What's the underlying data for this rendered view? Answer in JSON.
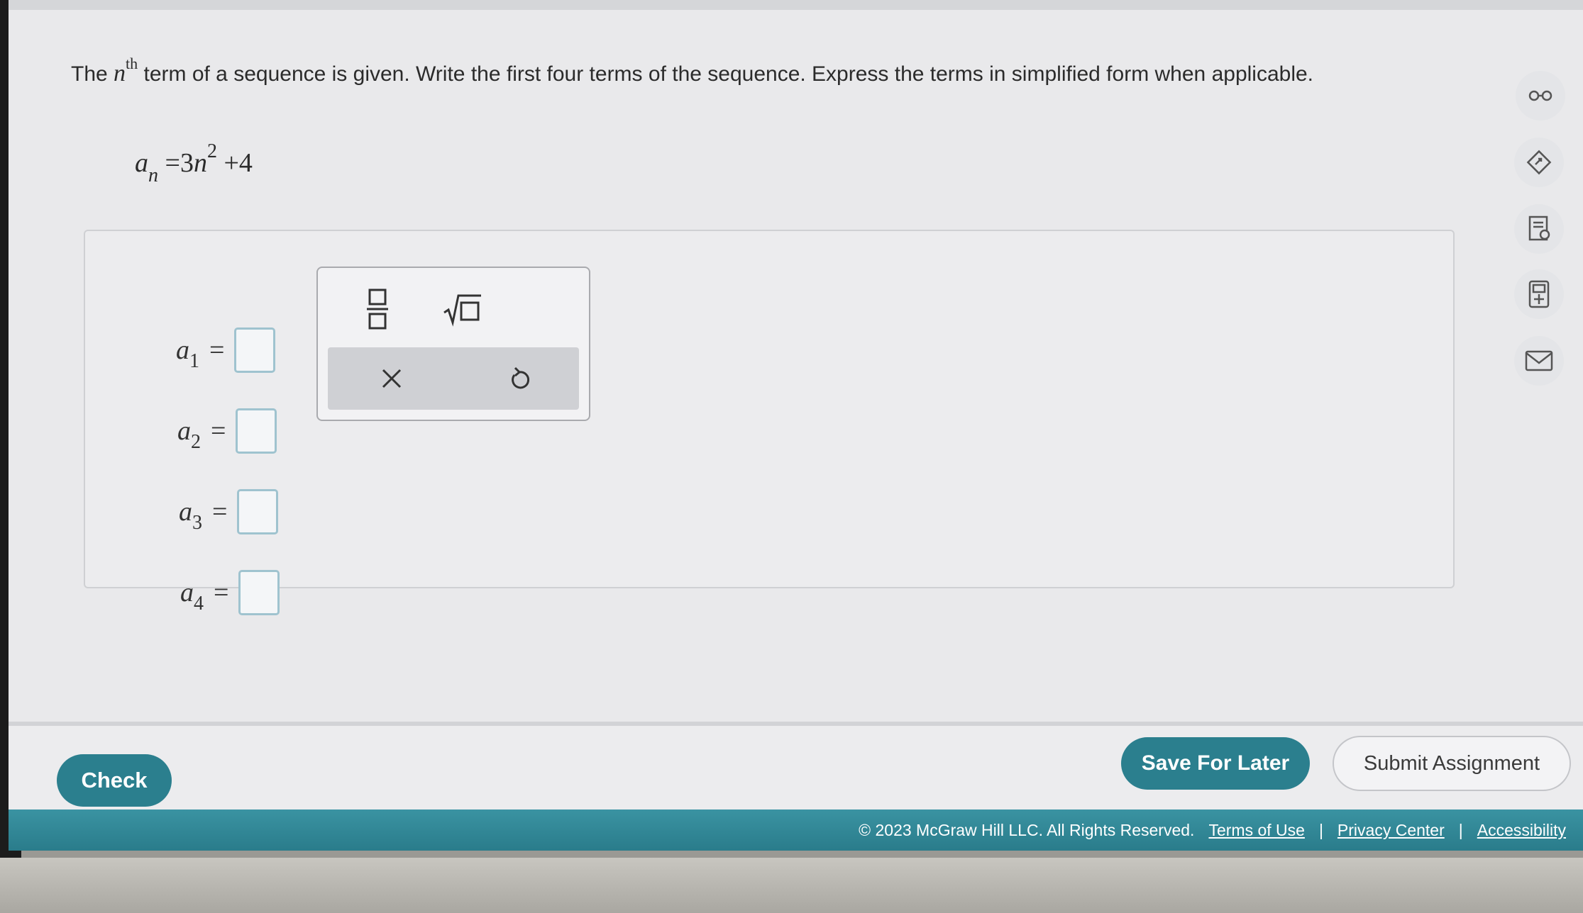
{
  "question": {
    "text_part1": "The ",
    "var_n": "n",
    "sup_th": "th",
    "text_part2": " term of a sequence is given. Write the first four terms of the sequence. Express the terms in simplified form when applicable."
  },
  "formula": {
    "lhs": "a",
    "lhs_sub": "n",
    "equals": "=",
    "coef": "3",
    "var": "n",
    "exp": "2",
    "tail": "+4"
  },
  "answers": [
    {
      "label": "a",
      "sub": "1",
      "value": ""
    },
    {
      "label": "a",
      "sub": "2",
      "value": ""
    },
    {
      "label": "a",
      "sub": "3",
      "value": ""
    },
    {
      "label": "a",
      "sub": "4",
      "value": ""
    }
  ],
  "equals_sign": "=",
  "palette": {
    "fraction_icon": "fraction-template-icon",
    "sqrt_icon": "square-root-template-icon",
    "clear_icon": "clear-x-icon",
    "undo_icon": "undo-icon"
  },
  "rail": [
    "glasses-icon",
    "tag-edit-icon",
    "textbook-icon",
    "calculator-icon",
    "mail-icon"
  ],
  "buttons": {
    "check": "Check",
    "save": "Save For Later",
    "submit": "Submit Assignment"
  },
  "footer": {
    "copyright": "© 2023 McGraw Hill LLC. All Rights Reserved.",
    "terms": "Terms of Use",
    "sep1": "|",
    "privacy": "Privacy Center",
    "sep2": "|",
    "accessibility": "Accessibility"
  },
  "colors": {
    "teal": "#2b7f8e",
    "answer_box_border": "#9fc3cf"
  }
}
